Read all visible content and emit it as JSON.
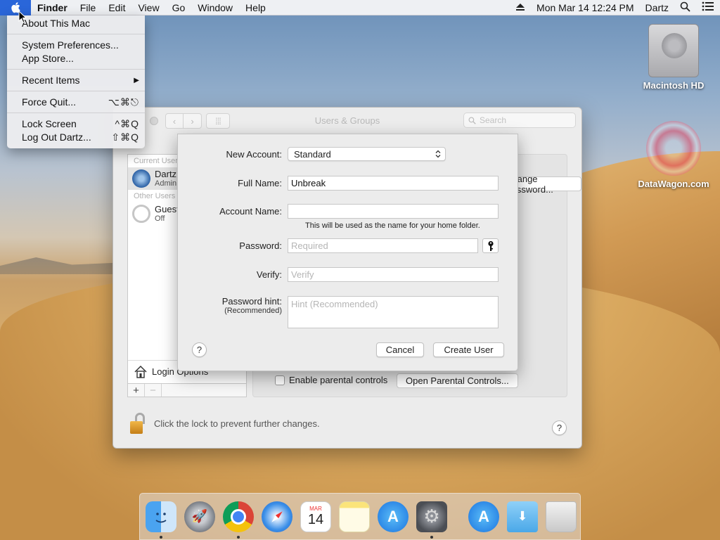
{
  "menubar": {
    "app_name": "Finder",
    "menus": [
      "File",
      "Edit",
      "View",
      "Go",
      "Window",
      "Help"
    ],
    "clock": "Mon Mar 14  12:24 PM",
    "user": "Dartz"
  },
  "apple_menu": {
    "about": "About This Mac",
    "system_prefs": "System Preferences...",
    "app_store": "App Store...",
    "recent_items": "Recent Items",
    "force_quit": "Force Quit...",
    "force_quit_shortcut": "⌥⌘⎋",
    "lock_screen": "Lock Screen",
    "lock_screen_shortcut": "^⌘Q",
    "log_out": "Log Out Dartz...",
    "log_out_shortcut": "⇧⌘Q"
  },
  "desktop": {
    "hd_label": "Macintosh HD",
    "datawagon_label": "DataWagon.com"
  },
  "window": {
    "title": "Users & Groups",
    "search_placeholder": "Search",
    "current_user_header": "Current User",
    "current_user_name": "Dartz",
    "current_user_role": "Admin",
    "other_users_header": "Other Users",
    "guest_name": "Guest User",
    "guest_status": "Off",
    "login_options": "Login Options",
    "change_password_btn": "Change Password...",
    "parental_checkbox": "Enable parental controls",
    "open_parental_btn": "Open Parental Controls...",
    "lock_text": "Click the lock to prevent further changes."
  },
  "sheet": {
    "new_account_label": "New Account:",
    "new_account_value": "Standard",
    "full_name_label": "Full Name:",
    "full_name_value": "Unbreak",
    "account_name_label": "Account Name:",
    "account_name_value": "",
    "account_note": "This will be used as the name for your home folder.",
    "password_label": "Password:",
    "password_placeholder": "Required",
    "verify_label": "Verify:",
    "verify_placeholder": "Verify",
    "hint_label": "Password hint:",
    "hint_sub": "(Recommended)",
    "hint_placeholder": "Hint (Recommended)",
    "cancel": "Cancel",
    "create_user": "Create User"
  },
  "dock": {
    "calendar_month": "MAR",
    "calendar_day": "14"
  }
}
